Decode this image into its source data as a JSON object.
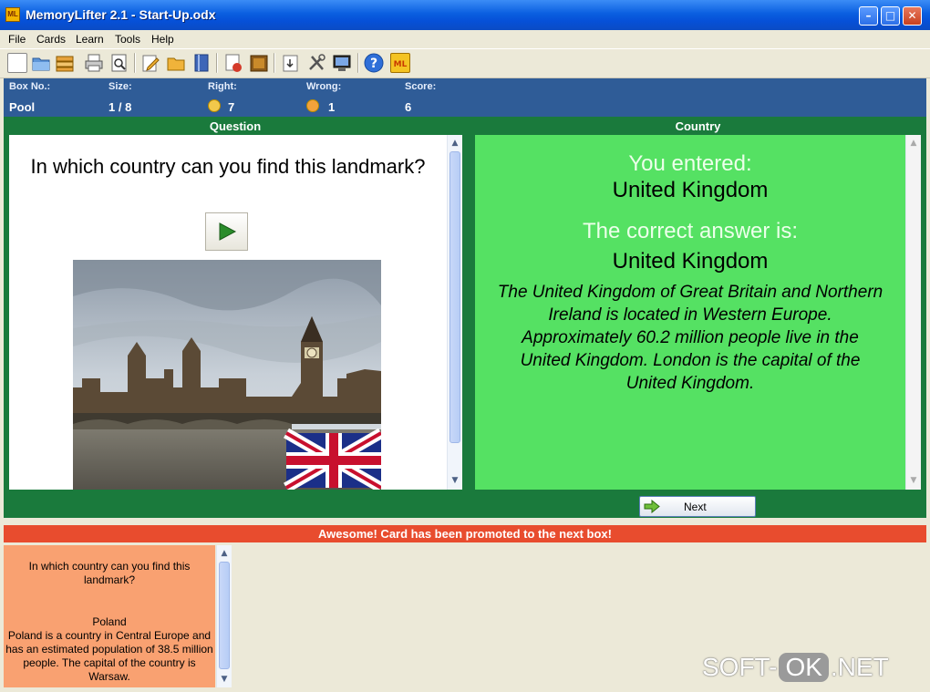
{
  "window": {
    "title": "MemoryLifter 2.1 - Start-Up.odx",
    "icon_text": "ML"
  },
  "menu": [
    "File",
    "Cards",
    "Learn",
    "Tools",
    "Help"
  ],
  "toolbar_icons": [
    "new-file-icon",
    "open-folder-icon",
    "open-stack-icon",
    "print-icon",
    "print-preview-icon",
    "edit-card-icon",
    "folder-icon",
    "book-icon",
    "card-delete-icon",
    "box-icon",
    "import-icon",
    "tools-icon",
    "screen-icon",
    "help-icon",
    "memorylifter-logo-icon"
  ],
  "stats": {
    "box_label": "Box No.:",
    "box_value": "Pool",
    "size_label": "Size:",
    "size_value": "1 / 8",
    "right_label": "Right:",
    "right_value": "7",
    "wrong_label": "Wrong:",
    "wrong_value": "1",
    "score_label": "Score:",
    "score_value": "6"
  },
  "question_pane": {
    "header": "Question",
    "text": "In which country can you find this landmark?"
  },
  "answer_pane": {
    "header": "Country",
    "you_entered_label": "You entered:",
    "you_entered_value": "United Kingdom",
    "correct_label": "The correct answer is:",
    "correct_value": "United Kingdom",
    "description": "The United Kingdom of Great Britain and Northern Ireland is located in Western Europe. Approximately 60.2 million people live in the United Kingdom. London is the capital of the United Kingdom."
  },
  "next_button": "Next",
  "banner": "Awesome! Card has been promoted to the next box!",
  "history_card": {
    "question": "In which country can you find this landmark?",
    "answer": "Poland",
    "description": "Poland is a country in Central Europe and has an estimated population of 38.5 million people. The capital of the country is Warsaw."
  },
  "watermark": {
    "left": "SOFT-",
    "mid": "OK",
    "right": ".NET"
  },
  "colors": {
    "stats_bar": "#2f5c97",
    "frame_green": "#1a7a3c",
    "answer_bg": "#55e163",
    "banner_red": "#e84c2e",
    "history_card_bg": "#f9a171"
  }
}
